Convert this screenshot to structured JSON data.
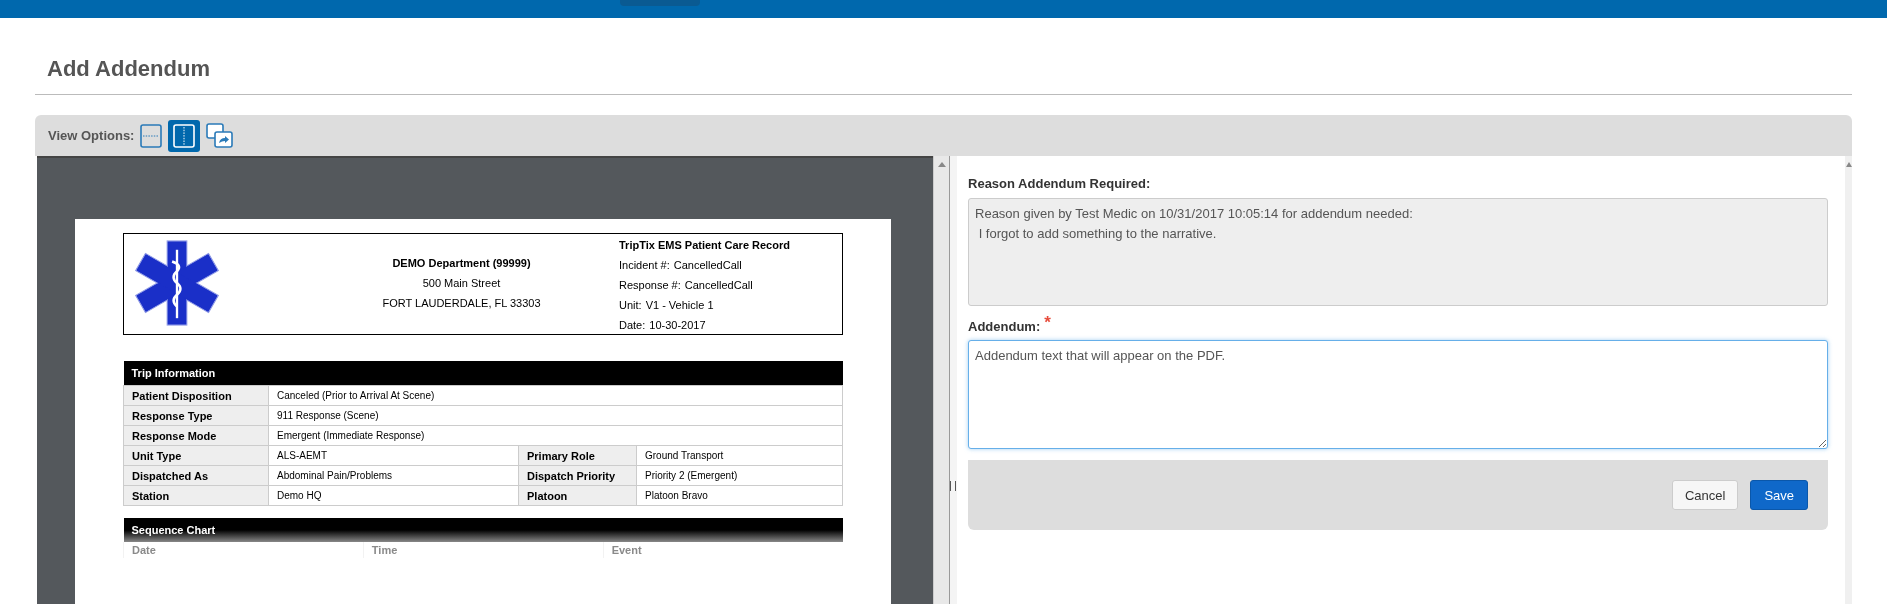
{
  "page_title": "Add Addendum",
  "view_options": {
    "label": "View Options:",
    "options": [
      {
        "kind": "horizontal",
        "selected": false
      },
      {
        "kind": "vertical",
        "selected": true
      },
      {
        "kind": "popout",
        "selected": false
      }
    ]
  },
  "document": {
    "header": {
      "department": "DEMO Department (99999)",
      "street": "500 Main Street",
      "city": "FORT LAUDERDALE, FL 33303",
      "record_title": "TripTix EMS Patient Care Record",
      "fields": [
        {
          "label": "Incident #:",
          "value": "CancelledCall"
        },
        {
          "label": "Response #:",
          "value": "CancelledCall"
        },
        {
          "label": "Unit:",
          "value": "V1 - Vehicle 1"
        },
        {
          "label": "Date:",
          "value": "10-30-2017"
        }
      ]
    },
    "trip_information": {
      "title": "Trip Information",
      "rows": [
        [
          {
            "label": "Patient Disposition",
            "value": "Canceled (Prior to Arrival At Scene)"
          }
        ],
        [
          {
            "label": "Response Type",
            "value": "911 Response (Scene)"
          }
        ],
        [
          {
            "label": "Response Mode",
            "value": "Emergent (Immediate Response)"
          }
        ],
        [
          {
            "label": "Unit Type",
            "value": "ALS-AEMT"
          },
          {
            "label": "Primary Role",
            "value": "Ground Transport"
          }
        ],
        [
          {
            "label": "Dispatched As",
            "value": "Abdominal Pain/Problems"
          },
          {
            "label": "Dispatch Priority",
            "value": "Priority 2 (Emergent)"
          }
        ],
        [
          {
            "label": "Station",
            "value": "Demo HQ"
          },
          {
            "label": "Platoon",
            "value": "Platoon Bravo"
          }
        ]
      ]
    },
    "sequence_chart": {
      "title": "Sequence Chart",
      "columns": [
        "Date",
        "Time",
        "Event"
      ]
    }
  },
  "reason": {
    "label": "Reason Addendum Required:",
    "value": "Reason given by Test Medic on 10/31/2017 10:05:14 for addendum needed:\n I forgot to add something to the narrative."
  },
  "addendum": {
    "label": "Addendum:",
    "required_mark": "*",
    "value": "Addendum text that will appear on the PDF."
  },
  "buttons": [
    {
      "kind": "secondary",
      "label": "Cancel"
    },
    {
      "kind": "primary",
      "label": "Save"
    }
  ]
}
